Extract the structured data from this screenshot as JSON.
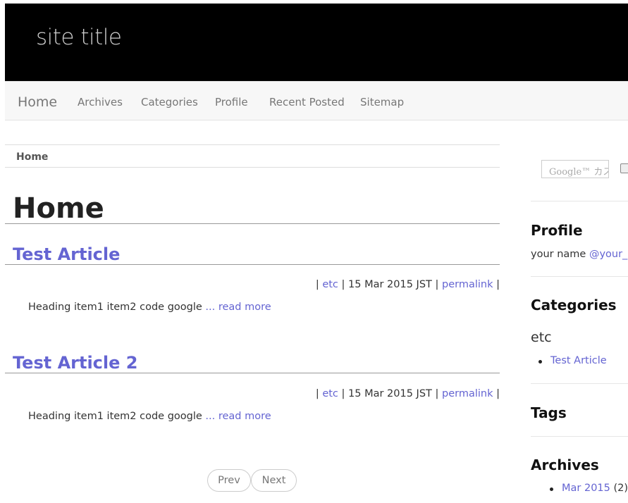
{
  "header": {
    "site_title": "site title"
  },
  "nav": {
    "brand": "Home",
    "items": [
      "Archives",
      "Categories",
      "Profile",
      "Recent Posted",
      "Sitemap"
    ]
  },
  "breadcrumb": {
    "current": "Home"
  },
  "main": {
    "page_title": "Home",
    "articles": [
      {
        "title": "Test Article",
        "meta_prefix": "| ",
        "category": "etc",
        "date": " | 15 Mar 2015 JST | ",
        "permalink": "permalink",
        "meta_suffix": " |",
        "excerpt": "Heading item1 item2 code google ",
        "ellipsis": "...",
        "read_more": " read more"
      },
      {
        "title": "Test Article 2",
        "meta_prefix": "| ",
        "category": "etc",
        "date": " | 15 Mar 2015 JST | ",
        "permalink": "permalink",
        "meta_suffix": " |",
        "excerpt": "Heading item1 item2 code google ",
        "ellipsis": "...",
        "read_more": " read more"
      }
    ],
    "pager": {
      "prev": "Prev",
      "next": "Next"
    }
  },
  "sidebar": {
    "search_placeholder": "Google™ カス",
    "profile": {
      "heading": "Profile",
      "name": "your name ",
      "handle": "@your_ac"
    },
    "categories": {
      "heading": "Categories",
      "group": "etc",
      "items": [
        "Test Article"
      ]
    },
    "tags": {
      "heading": "Tags"
    },
    "archives": {
      "heading": "Archives",
      "items": [
        {
          "label": "Mar 2015",
          "count": " (2)"
        }
      ]
    }
  },
  "colors": {
    "header_bg": "#000000",
    "link": "#6464d2",
    "nav_bg": "#f7f7f7"
  }
}
